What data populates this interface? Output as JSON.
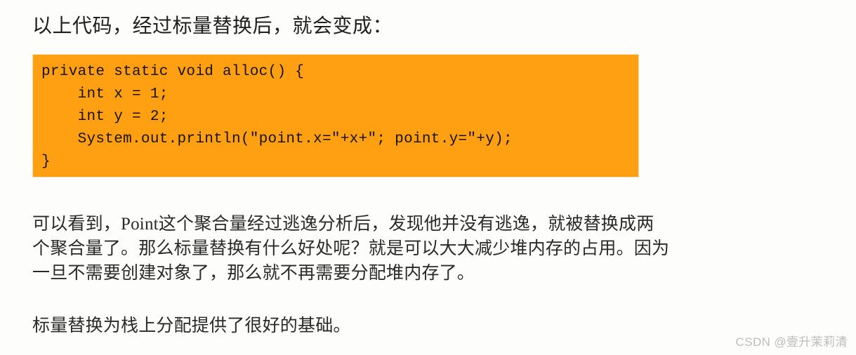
{
  "document": {
    "background_color": "#fdfdfb",
    "intro_text": "以上代码，经过标量替换后，就会变成："
  },
  "code_block": {
    "background_color": "#FFA012",
    "text_color": "#1a1208",
    "language": "java",
    "lines": [
      "private static void alloc() {",
      "    int x = 1;",
      "    int y = 2;",
      "    System.out.println(\"point.x=\"+x+\"; point.y=\"+y);",
      "}"
    ],
    "code": "private static void alloc() {\n    int x = 1;\n    int y = 2;\n    System.out.println(\"point.x=\"+x+\"; point.y=\"+y);\n}"
  },
  "paragraphs": [
    {
      "id": "para-1",
      "lines": [
        "可以看到，Point这个聚合量经过逃逸分析后，发现他并没有逃逸，就被替换成两",
        "个聚合量了。那么标量替换有什么好处呢？就是可以大大减少堆内存的占用。因为",
        "一旦不需要创建对象了，那么就不再需要分配堆内存了。"
      ]
    },
    {
      "id": "para-2",
      "lines": [
        "标量替换为栈上分配提供了很好的基础。"
      ]
    }
  ],
  "watermark": {
    "brand": "CSDN",
    "author": "@壹升茉莉清",
    "color": "#bdbdbd"
  }
}
